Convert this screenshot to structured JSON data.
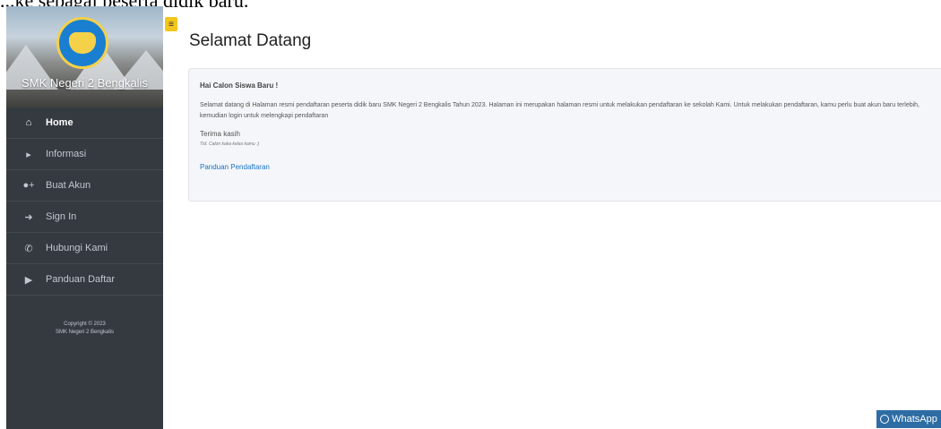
{
  "overflow_text": "...ke sebagai peserta didik baru.",
  "sidebar": {
    "school_name": "SMK Negeri 2 Bengkalis",
    "items": [
      {
        "label": "Home",
        "icon": "home-icon"
      },
      {
        "label": "Informasi",
        "icon": "megaphone-icon"
      },
      {
        "label": "Buat Akun",
        "icon": "user-plus-icon"
      },
      {
        "label": "Sign In",
        "icon": "sign-in-icon"
      },
      {
        "label": "Hubungi Kami",
        "icon": "phone-icon"
      },
      {
        "label": "Panduan Daftar",
        "icon": "video-icon"
      }
    ],
    "copyright_line1": "Copyright © 2023",
    "copyright_line2": "SMK Negeri 2 Bengkalis"
  },
  "main": {
    "title": "Selamat Datang",
    "card": {
      "greeting": "Hai Calon Siswa Baru !",
      "body": "Selamat datang di Halaman resmi pendaftaran peserta didik baru SMK Negeri 2 Bengkalis Tahun 2023. Halaman ini merupakan halaman resmi untuk melakukan pendaftaran ke sekolah Kami. Untuk melakukan pendaftaran, kamu perlu buat akun baru terlebih, kemudian login untuk melengkapi pendaftaran",
      "thanks": "Terima kasih",
      "signature": "Ttd. Calon kaka kelas kamu :)",
      "link": "Panduan Pendaftaran"
    }
  },
  "whatsapp": {
    "label": "WhatsApp"
  },
  "colors": {
    "sidebar_bg": "#343a40",
    "accent": "#f2c61d",
    "link": "#1a73c8",
    "whatsapp_bg": "#2e6da4"
  }
}
